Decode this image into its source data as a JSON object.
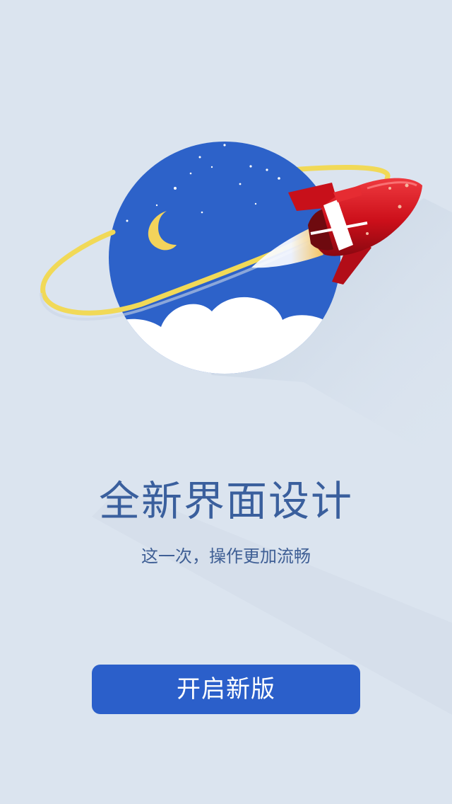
{
  "onboarding": {
    "title": "全新界面设计",
    "subtitle": "这一次，操作更加流畅",
    "cta_label": "开启新版"
  },
  "colors": {
    "background": "#dbe4ef",
    "title": "#3a5f9d",
    "button": "#2b5fca",
    "planet": "#2d62c9",
    "ring": "#f1d957",
    "rocket": "#d41a24"
  },
  "icons": {
    "moon": "crescent-moon-icon",
    "rocket": "rocket-icon",
    "planet": "planet-illustration"
  }
}
